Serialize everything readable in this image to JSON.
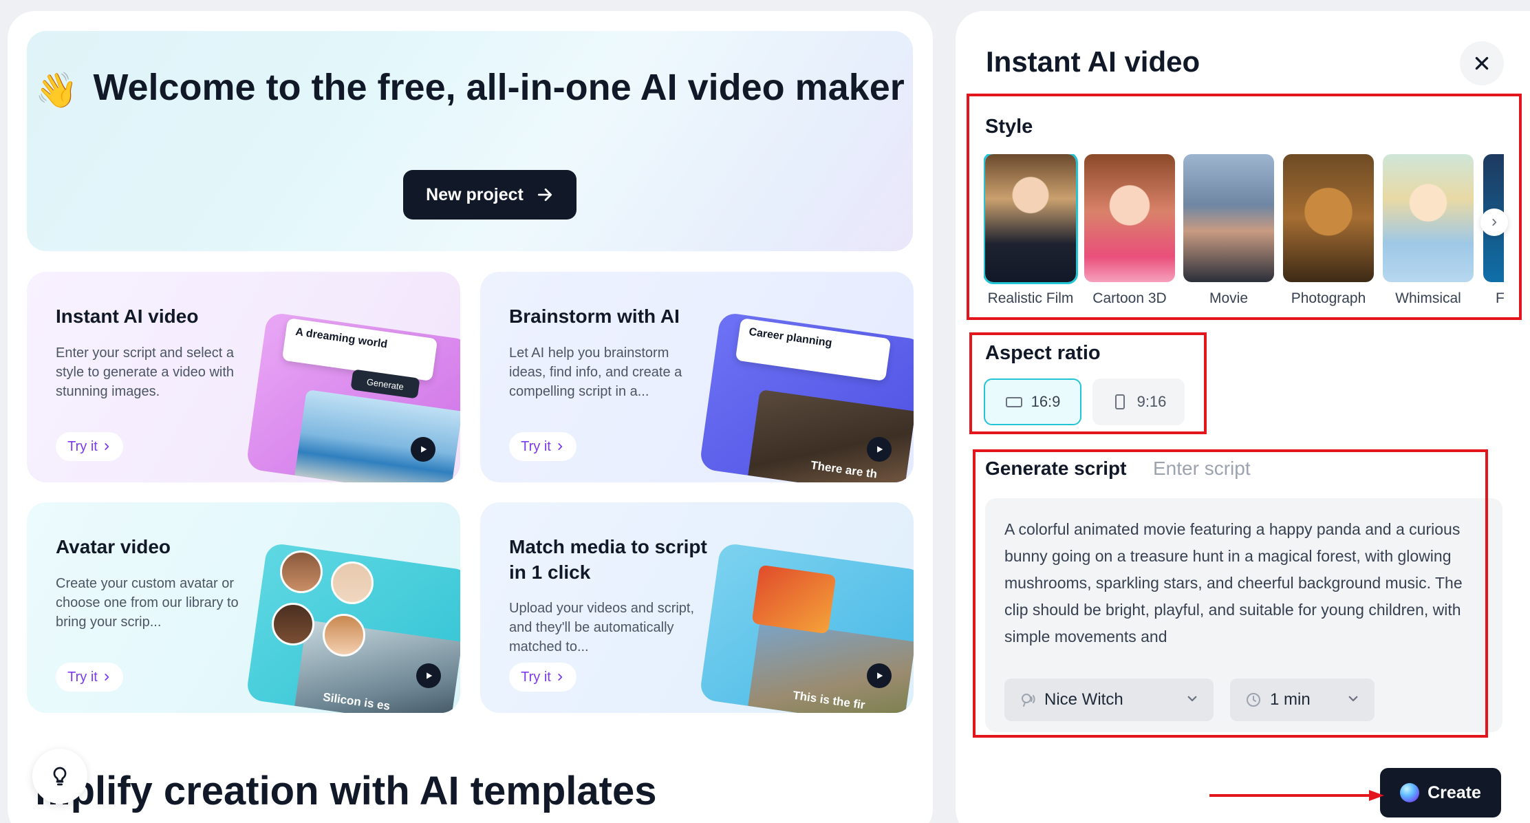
{
  "hero": {
    "wave_emoji": "👋",
    "title": "Welcome to the free, all-in-one AI video maker",
    "button": "New project"
  },
  "cards": [
    {
      "title": "Instant AI video",
      "desc": "Enter your script and select a style to generate a video with stunning images.",
      "try": "Try it",
      "art_chip": "A dreaming world",
      "art_button": "Generate"
    },
    {
      "title": "Brainstorm with AI",
      "desc": "Let AI help you brainstorm ideas, find info, and create a compelling script in a...",
      "try": "Try it",
      "art_chip": "Career planning",
      "art_caption": "There are th"
    },
    {
      "title": "Avatar video",
      "desc": "Create your custom avatar or choose one from our library to bring your scrip...",
      "try": "Try it",
      "art_caption": "Silicon is es"
    },
    {
      "title": "Match media to script in 1 click",
      "desc": "Upload your videos and script, and they'll be automatically matched to...",
      "try": "Try it",
      "art_caption": "This is the fir"
    }
  ],
  "templates_heading": "mplify creation with AI templates",
  "panel": {
    "title": "Instant AI video",
    "style_label": "Style",
    "styles": [
      {
        "name": "Realistic Film",
        "selected": true
      },
      {
        "name": "Cartoon 3D",
        "selected": false
      },
      {
        "name": "Movie",
        "selected": false
      },
      {
        "name": "Photograph",
        "selected": false
      },
      {
        "name": "Whimsical",
        "selected": false
      },
      {
        "name": "F",
        "selected": false
      }
    ],
    "aspect_label": "Aspect ratio",
    "aspect_options": [
      "16:9",
      "9:16"
    ],
    "aspect_selected": "16:9",
    "tab_generate": "Generate script",
    "tab_enter": "Enter script",
    "script_text": "A colorful animated movie featuring a happy panda and a curious bunny going on a treasure hunt in a magical forest, with glowing mushrooms, sparkling stars, and cheerful background music. The clip should be bright, playful, and suitable for young children, with simple movements and",
    "voice": "Nice Witch",
    "duration": "1 min",
    "create": "Create"
  },
  "colors": {
    "accent_cyan": "#22c4d6",
    "annotation_red": "#e3161e",
    "try_purple": "#7c3aed",
    "dark": "#111827"
  }
}
